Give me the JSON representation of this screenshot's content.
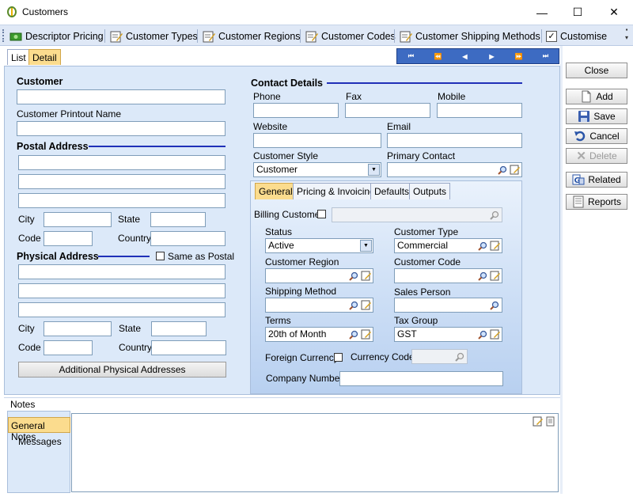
{
  "window": {
    "title": "Customers",
    "minimize": "—",
    "maximize": "☐",
    "close": "✕"
  },
  "toolbar": {
    "items": [
      "Descriptor Pricing",
      "Customer Types",
      "Customer Regions",
      "Customer Codes",
      "Customer Shipping Methods",
      "Customise"
    ]
  },
  "tabs": {
    "list": "List",
    "detail": "Detail"
  },
  "nav": [
    "⏮",
    "⏪",
    "◀",
    "▶",
    "⏩",
    "⏭"
  ],
  "customer": {
    "header": "Customer",
    "name": "",
    "printout_label": "Customer Printout Name",
    "printout": ""
  },
  "postal": {
    "header": "Postal Address",
    "city_label": "City",
    "state_label": "State",
    "code_label": "Code",
    "country_label": "Country"
  },
  "physical": {
    "header": "Physical Address",
    "same_label": "Same as Postal",
    "city_label": "City",
    "state_label": "State",
    "code_label": "Code",
    "country_label": "Country",
    "additional": "Additional Physical Addresses"
  },
  "contact": {
    "header": "Contact Details",
    "phone": "Phone",
    "fax": "Fax",
    "mobile": "Mobile",
    "website": "Website",
    "email": "Email",
    "style_label": "Customer Style",
    "style_value": "Customer",
    "primary_label": "Primary Contact"
  },
  "subtabs": {
    "general": "General",
    "pricing": "Pricing & Invoicing",
    "defaults": "Defaults",
    "outputs": "Outputs"
  },
  "general": {
    "billing_label": "Billing Customer",
    "status_label": "Status",
    "status_value": "Active",
    "type_label": "Customer Type",
    "type_value": "Commercial",
    "region_label": "Customer Region",
    "code_label": "Customer Code",
    "shipping_label": "Shipping Method",
    "sales_label": "Sales Person",
    "terms_label": "Terms",
    "terms_value": "20th of Month",
    "tax_label": "Tax Group",
    "tax_value": "GST",
    "foreign_label": "Foreign Currency",
    "currency_label": "Currency Code",
    "company_label": "Company Number"
  },
  "notes": {
    "label": "Notes",
    "tabs": [
      "General Notes",
      "Messages"
    ]
  },
  "side": {
    "close": "Close",
    "add": "Add",
    "save": "Save",
    "cancel": "Cancel",
    "delete": "Delete",
    "related": "Related",
    "reports": "Reports"
  }
}
